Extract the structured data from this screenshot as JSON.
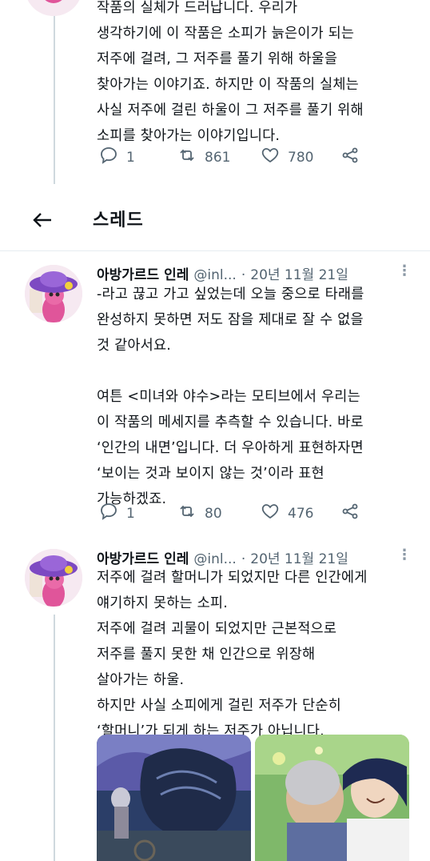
{
  "top_tweet": {
    "text": "작품의 실체가 드러납니다. 우리가\n생각하기에 이 작품은 소피가 늙은이가 되는\n저주에 걸려, 그 저주를 풀기 위해 하울을\n찾아가는 이야기죠. 하지만 이 작품의 실체는\n사실 저주에 걸린 하울이 그 저주를 풀기 위해\n소피를 찾아가는 이야기입니다.",
    "replies": "1",
    "retweets": "861",
    "likes": "780"
  },
  "header": {
    "title": "스레드"
  },
  "tweet1": {
    "name": "아방가르드 인레",
    "handle": "@inl...",
    "dot": "·",
    "date": "20년 11월 21일",
    "more": "⋮",
    "text": "-라고 끊고 가고 싶었는데 오늘 중으로 타래를\n완성하지 못하면 저도 잠을 제대로 잘 수 없을\n것 같아서요.\n\n여튼 <미녀와 야수>라는 모티브에서 우리는\n이 작품의 메세지를 추측할 수 있습니다. 바로\n‘인간의 내면’입니다. 더 우아하게 표현하자면\n‘보이는 것과 보이지 않는 것’이라 표현\n가능하겠죠.",
    "replies": "1",
    "retweets": "80",
    "likes": "476"
  },
  "tweet2": {
    "name": "아방가르드 인레",
    "handle": "@inl...",
    "dot": "·",
    "date": "20년 11월 21일",
    "more": "⋮",
    "text": "저주에 걸려 할머니가 되었지만 다른 인간에게\n얘기하지 못하는 소피.\n저주에 걸려 괴물이 되었지만 근본적으로\n저주를 풀지 못한 채 인간으로 위장해\n살아가는 하울.\n하지만 사실 소피에게 걸린 저주가 단순히\n‘할머니’가 되게 하는 저주가 아닙니다."
  },
  "icons": {
    "reply": "reply-icon",
    "retweet": "retweet-icon",
    "like": "heart-icon",
    "share": "share-icon",
    "back": "arrow-left-icon"
  },
  "colors": {
    "text": "#0f1419",
    "secondary": "#536471",
    "divider": "#e6ecf0"
  }
}
